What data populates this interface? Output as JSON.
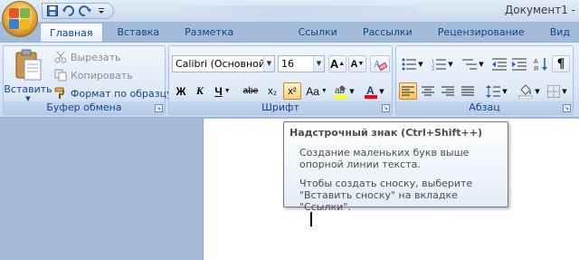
{
  "window": {
    "title": "Документ1 -"
  },
  "qat": {
    "icons": [
      "save-icon",
      "undo-icon",
      "redo-icon",
      "customize-icon"
    ]
  },
  "tabs": [
    "Главная",
    "Вставка",
    "Разметка страницы",
    "Ссылки",
    "Рассылки",
    "Рецензирование",
    "Вид"
  ],
  "clipboard": {
    "label": "Буфер обмена",
    "paste": "Вставить",
    "cut": "Вырезать",
    "copy": "Копировать",
    "format_painter": "Формат по образцу"
  },
  "font": {
    "label": "Шрифт",
    "name": "Calibri (Основной те",
    "size": "16",
    "bold": "Ж",
    "italic": "К",
    "underline": "Ч",
    "strike": "abe",
    "subscript": "x₂",
    "superscript": "x²",
    "case": "Aa",
    "grow": "A",
    "shrink": "A"
  },
  "paragraph": {
    "label": "Абзац",
    "pilcrow": "¶"
  },
  "tooltip": {
    "title": "Надстрочный знак (Ctrl+Shift++)",
    "line1": "Создание маленьких букв выше опорной линии текста.",
    "line2": "Чтобы создать сноску, выберите \"Вставить сноску\" на вкладке \"Ссылки\"."
  },
  "colors": {
    "highlight": "#ffff00",
    "font_color": "#ff0000",
    "accent": "#15428b"
  }
}
